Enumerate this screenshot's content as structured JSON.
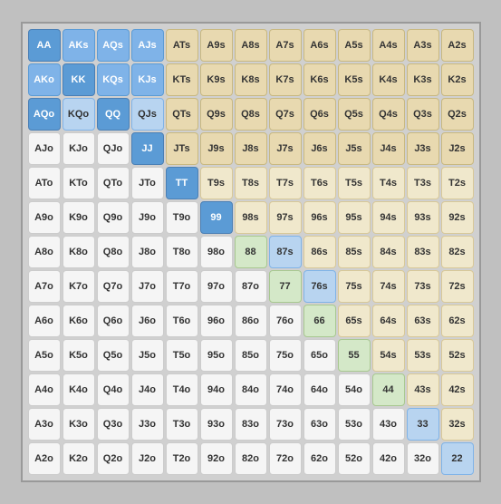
{
  "grid": {
    "rows": [
      [
        {
          "label": "AA",
          "cls": "blue-dark"
        },
        {
          "label": "AKs",
          "cls": "blue-med"
        },
        {
          "label": "AQs",
          "cls": "blue-med"
        },
        {
          "label": "AJs",
          "cls": "blue-med"
        },
        {
          "label": "ATs",
          "cls": "tan"
        },
        {
          "label": "A9s",
          "cls": "tan"
        },
        {
          "label": "A8s",
          "cls": "tan"
        },
        {
          "label": "A7s",
          "cls": "tan"
        },
        {
          "label": "A6s",
          "cls": "tan"
        },
        {
          "label": "A5s",
          "cls": "tan"
        },
        {
          "label": "A4s",
          "cls": "tan"
        },
        {
          "label": "A3s",
          "cls": "tan"
        },
        {
          "label": "A2s",
          "cls": "tan"
        }
      ],
      [
        {
          "label": "AKo",
          "cls": "blue-med"
        },
        {
          "label": "KK",
          "cls": "blue-dark"
        },
        {
          "label": "KQs",
          "cls": "blue-med"
        },
        {
          "label": "KJs",
          "cls": "blue-med"
        },
        {
          "label": "KTs",
          "cls": "tan"
        },
        {
          "label": "K9s",
          "cls": "tan"
        },
        {
          "label": "K8s",
          "cls": "tan"
        },
        {
          "label": "K7s",
          "cls": "tan"
        },
        {
          "label": "K6s",
          "cls": "tan"
        },
        {
          "label": "K5s",
          "cls": "tan"
        },
        {
          "label": "K4s",
          "cls": "tan"
        },
        {
          "label": "K3s",
          "cls": "tan"
        },
        {
          "label": "K2s",
          "cls": "tan"
        }
      ],
      [
        {
          "label": "AQo",
          "cls": "blue-dark"
        },
        {
          "label": "KQo",
          "cls": "blue-light"
        },
        {
          "label": "QQ",
          "cls": "blue-dark"
        },
        {
          "label": "QJs",
          "cls": "blue-light"
        },
        {
          "label": "QTs",
          "cls": "tan"
        },
        {
          "label": "Q9s",
          "cls": "tan"
        },
        {
          "label": "Q8s",
          "cls": "tan"
        },
        {
          "label": "Q7s",
          "cls": "tan"
        },
        {
          "label": "Q6s",
          "cls": "tan"
        },
        {
          "label": "Q5s",
          "cls": "tan"
        },
        {
          "label": "Q4s",
          "cls": "tan"
        },
        {
          "label": "Q3s",
          "cls": "tan"
        },
        {
          "label": "Q2s",
          "cls": "tan"
        }
      ],
      [
        {
          "label": "AJo",
          "cls": "white-cell"
        },
        {
          "label": "KJo",
          "cls": "white-cell"
        },
        {
          "label": "QJo",
          "cls": "white-cell"
        },
        {
          "label": "JJ",
          "cls": "blue-dark"
        },
        {
          "label": "JTs",
          "cls": "tan"
        },
        {
          "label": "J9s",
          "cls": "tan"
        },
        {
          "label": "J8s",
          "cls": "tan"
        },
        {
          "label": "J7s",
          "cls": "tan"
        },
        {
          "label": "J6s",
          "cls": "tan"
        },
        {
          "label": "J5s",
          "cls": "tan"
        },
        {
          "label": "J4s",
          "cls": "tan"
        },
        {
          "label": "J3s",
          "cls": "tan"
        },
        {
          "label": "J2s",
          "cls": "tan"
        }
      ],
      [
        {
          "label": "ATo",
          "cls": "white-cell"
        },
        {
          "label": "KTo",
          "cls": "white-cell"
        },
        {
          "label": "QTo",
          "cls": "white-cell"
        },
        {
          "label": "JTo",
          "cls": "white-cell"
        },
        {
          "label": "TT",
          "cls": "blue-dark"
        },
        {
          "label": "T9s",
          "cls": "tan-light"
        },
        {
          "label": "T8s",
          "cls": "tan-light"
        },
        {
          "label": "T7s",
          "cls": "tan-light"
        },
        {
          "label": "T6s",
          "cls": "tan-light"
        },
        {
          "label": "T5s",
          "cls": "tan-light"
        },
        {
          "label": "T4s",
          "cls": "tan-light"
        },
        {
          "label": "T3s",
          "cls": "tan-light"
        },
        {
          "label": "T2s",
          "cls": "tan-light"
        }
      ],
      [
        {
          "label": "A9o",
          "cls": "white-cell"
        },
        {
          "label": "K9o",
          "cls": "white-cell"
        },
        {
          "label": "Q9o",
          "cls": "white-cell"
        },
        {
          "label": "J9o",
          "cls": "white-cell"
        },
        {
          "label": "T9o",
          "cls": "white-cell"
        },
        {
          "label": "99",
          "cls": "blue-dark"
        },
        {
          "label": "98s",
          "cls": "tan-light"
        },
        {
          "label": "97s",
          "cls": "tan-light"
        },
        {
          "label": "96s",
          "cls": "tan-light"
        },
        {
          "label": "95s",
          "cls": "tan-light"
        },
        {
          "label": "94s",
          "cls": "tan-light"
        },
        {
          "label": "93s",
          "cls": "tan-light"
        },
        {
          "label": "92s",
          "cls": "tan-light"
        }
      ],
      [
        {
          "label": "A8o",
          "cls": "white-cell"
        },
        {
          "label": "K8o",
          "cls": "white-cell"
        },
        {
          "label": "Q8o",
          "cls": "white-cell"
        },
        {
          "label": "J8o",
          "cls": "white-cell"
        },
        {
          "label": "T8o",
          "cls": "white-cell"
        },
        {
          "label": "98o",
          "cls": "white-cell"
        },
        {
          "label": "88",
          "cls": "green-light"
        },
        {
          "label": "87s",
          "cls": "blue-light"
        },
        {
          "label": "86s",
          "cls": "tan-light"
        },
        {
          "label": "85s",
          "cls": "tan-light"
        },
        {
          "label": "84s",
          "cls": "tan-light"
        },
        {
          "label": "83s",
          "cls": "tan-light"
        },
        {
          "label": "82s",
          "cls": "tan-light"
        }
      ],
      [
        {
          "label": "A7o",
          "cls": "white-cell"
        },
        {
          "label": "K7o",
          "cls": "white-cell"
        },
        {
          "label": "Q7o",
          "cls": "white-cell"
        },
        {
          "label": "J7o",
          "cls": "white-cell"
        },
        {
          "label": "T7o",
          "cls": "white-cell"
        },
        {
          "label": "97o",
          "cls": "white-cell"
        },
        {
          "label": "87o",
          "cls": "white-cell"
        },
        {
          "label": "77",
          "cls": "green-light"
        },
        {
          "label": "76s",
          "cls": "blue-light"
        },
        {
          "label": "75s",
          "cls": "tan-light"
        },
        {
          "label": "74s",
          "cls": "tan-light"
        },
        {
          "label": "73s",
          "cls": "tan-light"
        },
        {
          "label": "72s",
          "cls": "tan-light"
        }
      ],
      [
        {
          "label": "A6o",
          "cls": "white-cell"
        },
        {
          "label": "K6o",
          "cls": "white-cell"
        },
        {
          "label": "Q6o",
          "cls": "white-cell"
        },
        {
          "label": "J6o",
          "cls": "white-cell"
        },
        {
          "label": "T6o",
          "cls": "white-cell"
        },
        {
          "label": "96o",
          "cls": "white-cell"
        },
        {
          "label": "86o",
          "cls": "white-cell"
        },
        {
          "label": "76o",
          "cls": "white-cell"
        },
        {
          "label": "66",
          "cls": "green-light"
        },
        {
          "label": "65s",
          "cls": "tan-light"
        },
        {
          "label": "64s",
          "cls": "tan-light"
        },
        {
          "label": "63s",
          "cls": "tan-light"
        },
        {
          "label": "62s",
          "cls": "tan-light"
        }
      ],
      [
        {
          "label": "A5o",
          "cls": "white-cell"
        },
        {
          "label": "K5o",
          "cls": "white-cell"
        },
        {
          "label": "Q5o",
          "cls": "white-cell"
        },
        {
          "label": "J5o",
          "cls": "white-cell"
        },
        {
          "label": "T5o",
          "cls": "white-cell"
        },
        {
          "label": "95o",
          "cls": "white-cell"
        },
        {
          "label": "85o",
          "cls": "white-cell"
        },
        {
          "label": "75o",
          "cls": "white-cell"
        },
        {
          "label": "65o",
          "cls": "white-cell"
        },
        {
          "label": "55",
          "cls": "green-light"
        },
        {
          "label": "54s",
          "cls": "tan-light"
        },
        {
          "label": "53s",
          "cls": "tan-light"
        },
        {
          "label": "52s",
          "cls": "tan-light"
        }
      ],
      [
        {
          "label": "A4o",
          "cls": "white-cell"
        },
        {
          "label": "K4o",
          "cls": "white-cell"
        },
        {
          "label": "Q4o",
          "cls": "white-cell"
        },
        {
          "label": "J4o",
          "cls": "white-cell"
        },
        {
          "label": "T4o",
          "cls": "white-cell"
        },
        {
          "label": "94o",
          "cls": "white-cell"
        },
        {
          "label": "84o",
          "cls": "white-cell"
        },
        {
          "label": "74o",
          "cls": "white-cell"
        },
        {
          "label": "64o",
          "cls": "white-cell"
        },
        {
          "label": "54o",
          "cls": "white-cell"
        },
        {
          "label": "44",
          "cls": "green-light"
        },
        {
          "label": "43s",
          "cls": "tan-light"
        },
        {
          "label": "42s",
          "cls": "tan-light"
        }
      ],
      [
        {
          "label": "A3o",
          "cls": "white-cell"
        },
        {
          "label": "K3o",
          "cls": "white-cell"
        },
        {
          "label": "Q3o",
          "cls": "white-cell"
        },
        {
          "label": "J3o",
          "cls": "white-cell"
        },
        {
          "label": "T3o",
          "cls": "white-cell"
        },
        {
          "label": "93o",
          "cls": "white-cell"
        },
        {
          "label": "83o",
          "cls": "white-cell"
        },
        {
          "label": "73o",
          "cls": "white-cell"
        },
        {
          "label": "63o",
          "cls": "white-cell"
        },
        {
          "label": "53o",
          "cls": "white-cell"
        },
        {
          "label": "43o",
          "cls": "white-cell"
        },
        {
          "label": "33",
          "cls": "blue-light"
        },
        {
          "label": "32s",
          "cls": "tan-light"
        }
      ],
      [
        {
          "label": "A2o",
          "cls": "white-cell"
        },
        {
          "label": "K2o",
          "cls": "white-cell"
        },
        {
          "label": "Q2o",
          "cls": "white-cell"
        },
        {
          "label": "J2o",
          "cls": "white-cell"
        },
        {
          "label": "T2o",
          "cls": "white-cell"
        },
        {
          "label": "92o",
          "cls": "white-cell"
        },
        {
          "label": "82o",
          "cls": "white-cell"
        },
        {
          "label": "72o",
          "cls": "white-cell"
        },
        {
          "label": "62o",
          "cls": "white-cell"
        },
        {
          "label": "52o",
          "cls": "white-cell"
        },
        {
          "label": "42o",
          "cls": "white-cell"
        },
        {
          "label": "32o",
          "cls": "white-cell"
        },
        {
          "label": "22",
          "cls": "blue-light"
        }
      ]
    ]
  }
}
